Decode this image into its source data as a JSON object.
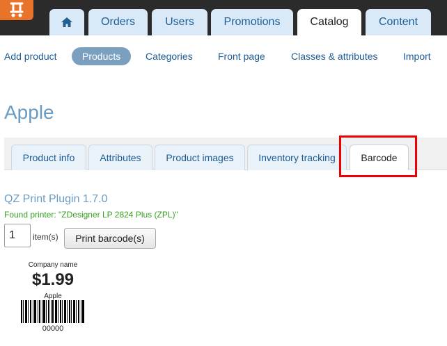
{
  "header": {
    "logo": "store-logo-icon",
    "home_icon": "home-icon",
    "tabs": [
      {
        "label": "Orders"
      },
      {
        "label": "Users"
      },
      {
        "label": "Promotions"
      },
      {
        "label": "Catalog",
        "active": true
      },
      {
        "label": "Content"
      }
    ]
  },
  "subnav": [
    {
      "label": "Add product"
    },
    {
      "label": "Products",
      "active": true
    },
    {
      "label": "Categories"
    },
    {
      "label": "Front page"
    },
    {
      "label": "Classes & attributes"
    },
    {
      "label": "Import"
    }
  ],
  "page": {
    "title": "Apple",
    "tabs": [
      {
        "label": "Product info"
      },
      {
        "label": "Attributes"
      },
      {
        "label": "Product images"
      },
      {
        "label": "Inventory tracking"
      },
      {
        "label": "Barcode",
        "active": true
      }
    ]
  },
  "barcode_panel": {
    "plugin_title": "QZ Print Plugin 1.7.0",
    "found_printer": "Found printer: \"ZDesigner LP 2824 Plus (ZPL)\"",
    "quantity_value": "1",
    "items_label": "item(s)",
    "print_button": "Print barcode(s)"
  },
  "label_preview": {
    "company_name": "Company name",
    "price": "$1.99",
    "product_name": "Apple",
    "code": "00000"
  },
  "colors": {
    "accent": "#6a9bc3",
    "tab_bg": "#d9e9f7",
    "success": "#35a020",
    "highlight": "#e00000",
    "logo": "#e8742c"
  }
}
